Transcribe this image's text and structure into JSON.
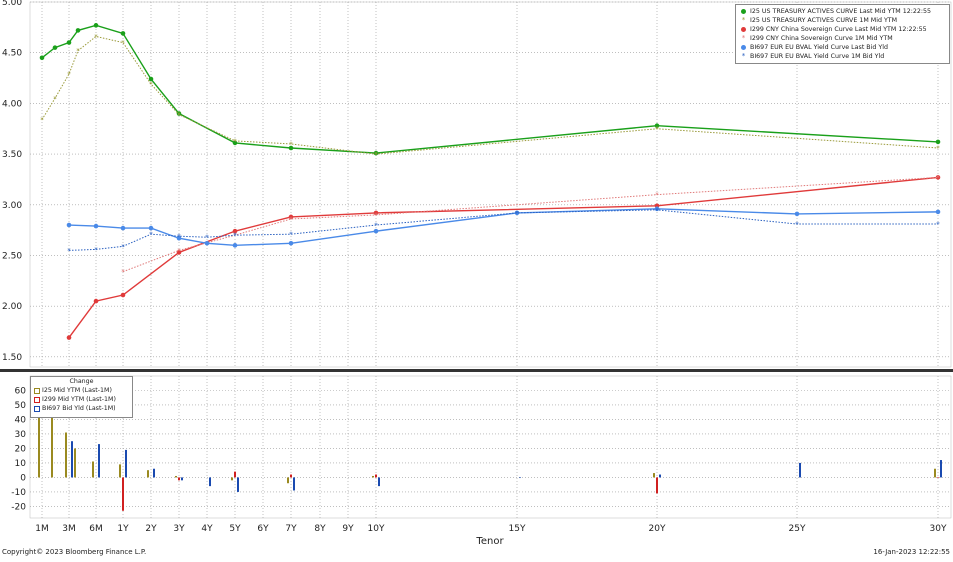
{
  "chart_data": [
    {
      "type": "line",
      "x_ticks": [
        "1M",
        "3M",
        "6M",
        "1Y",
        "2Y",
        "3Y",
        "4Y",
        "5Y",
        "6Y",
        "7Y",
        "8Y",
        "9Y",
        "10Y",
        "15Y",
        "20Y",
        "25Y",
        "30Y"
      ],
      "xlabel": "Tenor",
      "ylim": [
        1.4,
        5.0
      ],
      "y_ticks": [
        "5.00",
        "4.50",
        "4.00",
        "3.50",
        "3.00",
        "2.50",
        "2.00",
        "1.50"
      ],
      "grid": true,
      "legend_position": "top-right",
      "series": [
        {
          "name": "I25 US TREASURY ACTIVES CURVE Last Mid YTM 12:22:55",
          "color": "#1aa01a",
          "dash": "solid",
          "marker": "dot",
          "x": [
            "1M",
            "2M",
            "3M",
            "4M",
            "6M",
            "1Y",
            "2Y",
            "3Y",
            "5Y",
            "7Y",
            "10Y",
            "20Y",
            "30Y"
          ],
          "y": [
            4.45,
            4.55,
            4.6,
            4.72,
            4.77,
            4.69,
            4.24,
            3.9,
            3.61,
            3.56,
            3.51,
            3.78,
            3.62
          ]
        },
        {
          "name": "I25 US TREASURY ACTIVES CURVE 1M Mid YTM",
          "color": "#9a9a3a",
          "dash": "dotted",
          "marker": "star",
          "x": [
            "1M",
            "2M",
            "3M",
            "4M",
            "6M",
            "1Y",
            "2Y",
            "3Y",
            "5Y",
            "7Y",
            "10Y",
            "20Y",
            "30Y"
          ],
          "y": [
            3.84,
            4.05,
            4.29,
            4.52,
            4.66,
            4.6,
            4.19,
            3.89,
            3.63,
            3.6,
            3.5,
            3.75,
            3.56
          ]
        },
        {
          "name": "I299 CNY China Sovereign Curve Last Mid YTM 12:22:55",
          "color": "#e03a3a",
          "dash": "solid",
          "marker": "dot",
          "x": [
            "3M",
            "6M",
            "1Y",
            "3Y",
            "5Y",
            "7Y",
            "10Y",
            "20Y",
            "30Y"
          ],
          "y": [
            1.69,
            2.05,
            2.11,
            2.53,
            2.74,
            2.88,
            2.92,
            2.99,
            3.27
          ]
        },
        {
          "name": "I299 CNY China Sovereign Curve 1M Mid YTM",
          "color": "#e07a7a",
          "dash": "dotted",
          "marker": "star",
          "x": [
            "1Y",
            "3Y",
            "5Y",
            "7Y",
            "10Y",
            "20Y",
            "30Y"
          ],
          "y": [
            2.34,
            2.55,
            2.7,
            2.86,
            2.9,
            3.1,
            3.27
          ]
        },
        {
          "name": "BI697 EUR EU BVAL Yield Curve Last Bid Yld",
          "color": "#4a8ae8",
          "dash": "solid",
          "marker": "dot",
          "x": [
            "3M",
            "6M",
            "1Y",
            "2Y",
            "3Y",
            "4Y",
            "5Y",
            "7Y",
            "10Y",
            "15Y",
            "20Y",
            "25Y",
            "30Y"
          ],
          "y": [
            2.8,
            2.79,
            2.77,
            2.77,
            2.67,
            2.62,
            2.6,
            2.62,
            2.74,
            2.92,
            2.96,
            2.91,
            2.93
          ]
        },
        {
          "name": "BI697 EUR EU BVAL Yield Curve 1M Bid Yld",
          "color": "#2a60c0",
          "dash": "dotted",
          "marker": "star",
          "x": [
            "3M",
            "6M",
            "1Y",
            "2Y",
            "3Y",
            "4Y",
            "5Y",
            "7Y",
            "10Y",
            "15Y",
            "20Y",
            "25Y",
            "30Y"
          ],
          "y": [
            2.55,
            2.56,
            2.59,
            2.71,
            2.69,
            2.68,
            2.7,
            2.71,
            2.8,
            2.92,
            2.95,
            2.81,
            2.81
          ]
        }
      ]
    },
    {
      "type": "bar",
      "legend_title": "Change",
      "ylim": [
        -28,
        70
      ],
      "y_ticks": [
        "60",
        "50",
        "40",
        "30",
        "20",
        "10",
        "0",
        "-10",
        "-20"
      ],
      "legend_position": "top-left",
      "series": [
        {
          "name": "I25 Mid YTM (Last-1M)",
          "color": "#9a8a20",
          "x": [
            "1M",
            "2M",
            "3M",
            "4M",
            "6M",
            "1Y",
            "2Y",
            "3Y",
            "5Y",
            "7Y",
            "10Y",
            "20Y",
            "30Y"
          ],
          "values": [
            61,
            50,
            31,
            20,
            11,
            9,
            5,
            1,
            -2,
            -4,
            1,
            3,
            6
          ]
        },
        {
          "name": "I299 Mid YTM (Last-1M)",
          "color": "#d02020",
          "x": [
            "1Y",
            "3Y",
            "5Y",
            "7Y",
            "10Y",
            "20Y",
            "30Y"
          ],
          "values": [
            -23,
            -2,
            4,
            2,
            2,
            -11,
            0
          ]
        },
        {
          "name": "BI697 Bid Yld (Last-1M)",
          "color": "#1a4ab0",
          "x": [
            "3M",
            "6M",
            "1Y",
            "2Y",
            "3Y",
            "4Y",
            "5Y",
            "7Y",
            "10Y",
            "15Y",
            "20Y",
            "25Y",
            "30Y"
          ],
          "values": [
            25,
            23,
            19,
            6,
            -2,
            -6,
            -10,
            -9,
            -6,
            0,
            2,
            10,
            12
          ]
        }
      ]
    }
  ],
  "footer": {
    "copyright": "Copyright© 2023 Bloomberg Finance L.P.",
    "timestamp": "16-Jan-2023 12:22:55"
  }
}
